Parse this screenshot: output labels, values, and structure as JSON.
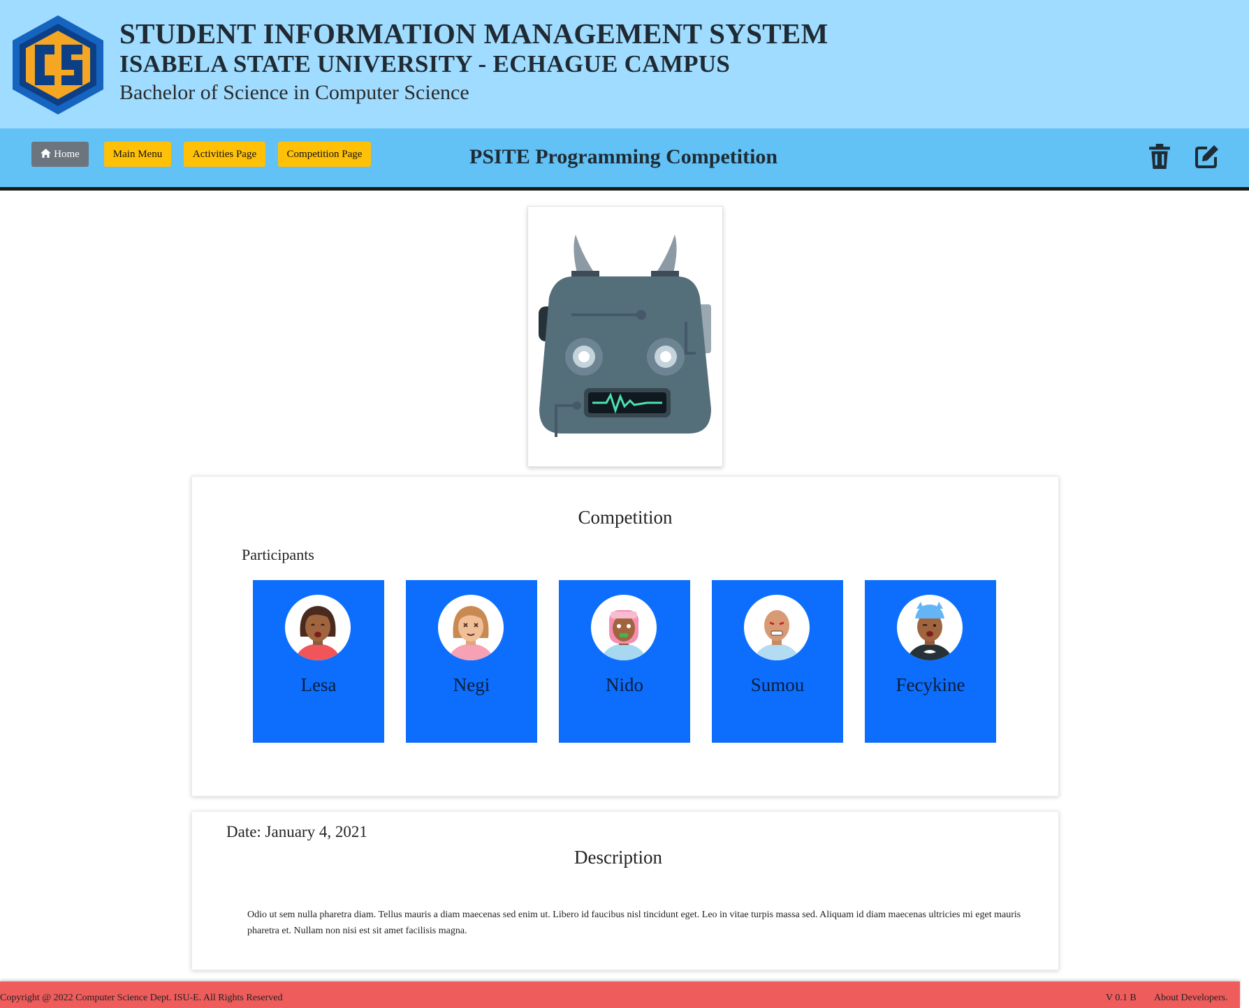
{
  "header": {
    "title": "STUDENT INFORMATION MANAGEMENT SYSTEM",
    "university": "ISABELA STATE UNIVERSITY - ECHAGUE CAMPUS",
    "program": "Bachelor of Science in Computer Science",
    "logo_text": "CS"
  },
  "nav": {
    "home_label": "Home",
    "main_menu_label": "Main Menu",
    "activities_label": "Activities Page",
    "competition_label": "Competition Page",
    "page_title": "PSITE Programming Competition"
  },
  "competition": {
    "heading": "Competition",
    "participants_label": "Participants",
    "participants": [
      {
        "name": "Lesa"
      },
      {
        "name": "Negi"
      },
      {
        "name": "Nido"
      },
      {
        "name": "Sumou"
      },
      {
        "name": "Fecykine"
      }
    ]
  },
  "details": {
    "date": "Date: January 4, 2021",
    "heading": "Description",
    "text": "Odio ut sem nulla pharetra diam. Tellus mauris a diam maecenas sed enim ut. Libero id faucibus nisl tincidunt eget. Leo in vitae turpis massa sed. Aliquam id diam maecenas ultricies mi eget mauris pharetra et. Nullam non nisi est sit amet facilisis magna."
  },
  "footer": {
    "copyright": "Copyright @ 2022 Computer Science Dept. ISU-E. All Rights Reserved",
    "version": "V 0.1 B",
    "about": "About Developers."
  },
  "colors": {
    "header_bg": "#9fdcff",
    "nav_bg": "#62c1f5",
    "home_button": "#6c757d",
    "yellow_button": "#ffc107",
    "participant_card": "#0d6efd",
    "footer_bg": "#ee5c5c"
  }
}
